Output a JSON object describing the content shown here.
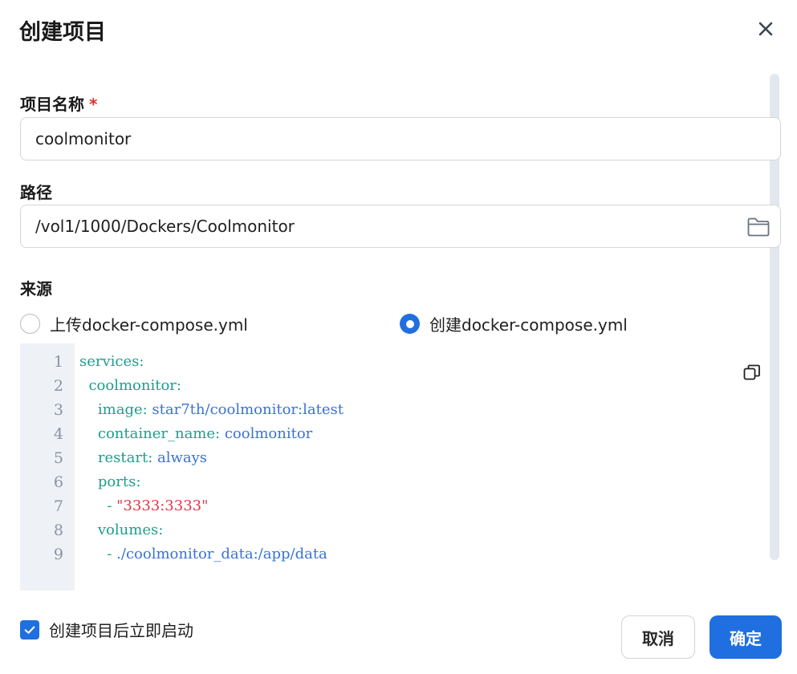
{
  "dialog": {
    "title": "创建项目"
  },
  "form": {
    "name": {
      "label": "项目名称",
      "required_mark": "*",
      "value": "coolmonitor"
    },
    "path": {
      "label": "路径",
      "value": "/vol1/1000/Dockers/Coolmonitor"
    },
    "source": {
      "label": "来源",
      "options": [
        {
          "label": "上传docker-compose.yml",
          "checked": false
        },
        {
          "label": "创建docker-compose.yml",
          "checked": true
        }
      ]
    }
  },
  "editor": {
    "lines": [
      {
        "n": "1",
        "indent": "",
        "key": "services",
        "sep": ":",
        "value": ""
      },
      {
        "n": "2",
        "indent": "  ",
        "key": "coolmonitor",
        "sep": ":",
        "value": ""
      },
      {
        "n": "3",
        "indent": "    ",
        "key": "image",
        "sep": ": ",
        "value": "star7th/coolmonitor",
        "sep2": ":",
        "value2": "latest"
      },
      {
        "n": "4",
        "indent": "    ",
        "key": "container_name",
        "sep": ": ",
        "value": "coolmonitor"
      },
      {
        "n": "5",
        "indent": "    ",
        "key": "restart",
        "sep": ": ",
        "value": "always"
      },
      {
        "n": "6",
        "indent": "    ",
        "key": "ports",
        "sep": ":",
        "value": ""
      },
      {
        "n": "7",
        "indent": "      ",
        "dash": "- ",
        "string": "\"3333:3333\""
      },
      {
        "n": "8",
        "indent": "    ",
        "key": "volumes",
        "sep": ":",
        "value": ""
      },
      {
        "n": "9",
        "indent": "      ",
        "dash": "- ",
        "value": "./coolmonitor_data:/app/data"
      }
    ]
  },
  "footer": {
    "autostart_label": "创建项目后立即启动",
    "autostart_checked": true,
    "cancel_label": "取消",
    "confirm_label": "确定"
  },
  "colors": {
    "accent": "#1f6fe0",
    "yaml_key": "#1c9e8f",
    "yaml_value": "#3a72d8",
    "yaml_string": "#e0364a",
    "required": "#e03131"
  },
  "icons": {
    "close": "close-icon",
    "folder": "folder-icon",
    "copy": "copy-icon",
    "check": "check-icon"
  }
}
